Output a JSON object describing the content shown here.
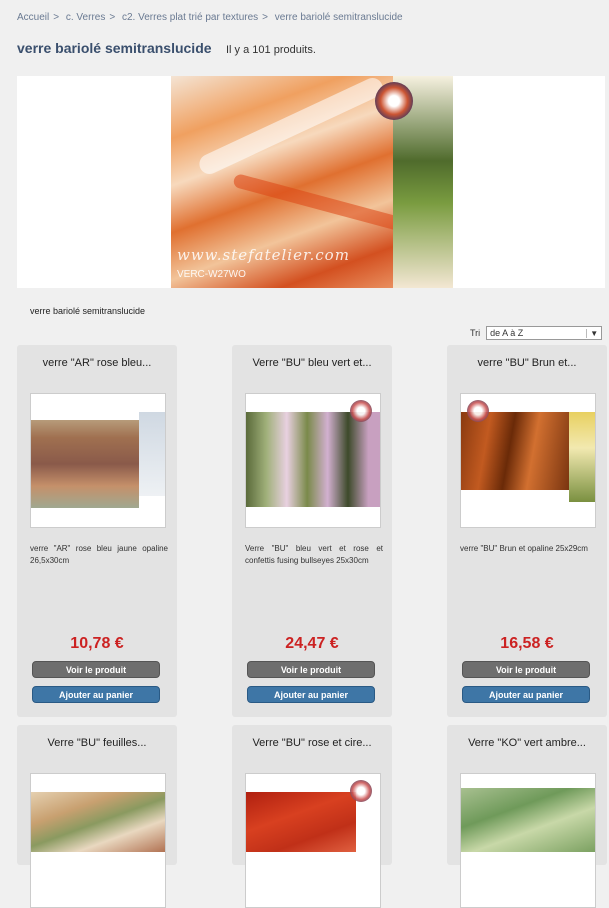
{
  "breadcrumb": [
    "Accueil",
    "c. Verres",
    "c2. Verres plat trié par textures",
    "verre bariolé semitranslucide"
  ],
  "breadcrumb_sep": ">",
  "page": {
    "title": "verre bariolé semitranslucide",
    "count": "Il y a 101 produits.",
    "description": "verre bariolé semitranslucide"
  },
  "banner": {
    "watermark": "www.stefatelier.com",
    "code": "VERC-W27WO"
  },
  "sort": {
    "label": "Tri",
    "selected": "de A à Z"
  },
  "buttons": {
    "view": "Voir le produit",
    "cart": "Ajouter au panier"
  },
  "products": [
    {
      "name": "verre \"AR\" rose bleu...",
      "desc": "verre \"AR\" rose bleu jaune opaline 26,5x30cm",
      "price": "10,78 €"
    },
    {
      "name": "Verre \"BU\" bleu vert et...",
      "desc": "Verre \"BU\" bleu vert et rose et confettis fusing bullseyes 25x30cm",
      "price": "24,47 €"
    },
    {
      "name": "verre \"BU\" Brun et...",
      "desc": "verre \"BU\" Brun et opaline 25x29cm",
      "price": "16,58 €"
    },
    {
      "name": "Verre \"BU\" feuilles...",
      "desc": "",
      "price": ""
    },
    {
      "name": "Verre \"BU\" rose et cire...",
      "desc": "",
      "price": ""
    },
    {
      "name": "Verre \"KO\" vert ambre...",
      "desc": "",
      "price": ""
    }
  ],
  "colors": {
    "price": "#cc2222",
    "cart_button": "#3e76a6",
    "view_button": "#6e6e6e",
    "title": "#3a4f6d"
  }
}
